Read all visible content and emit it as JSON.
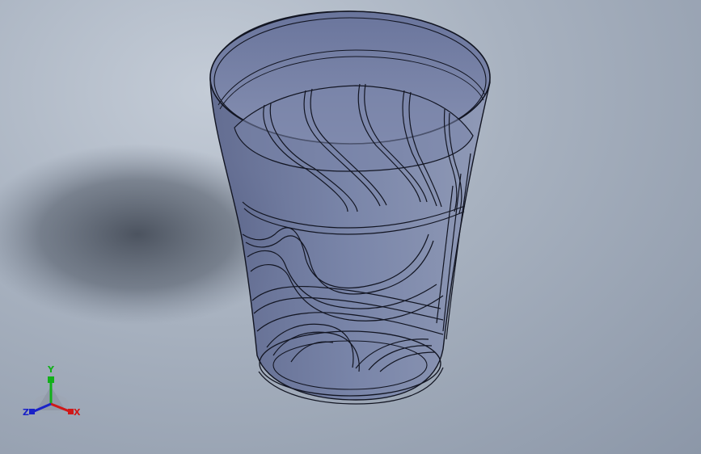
{
  "viewport": {
    "model": "cup-model",
    "colors": {
      "background_top": "#c4ccd7",
      "background_bottom": "#8c97a8",
      "shadow": "#3f4652",
      "model_fill": "#5f6a91",
      "edge": "#121522"
    }
  },
  "triad": {
    "x_label": "X",
    "y_label": "Y",
    "z_label": "Z",
    "colors": {
      "x": "#d01818",
      "y": "#12b01a",
      "z": "#1a22c8"
    }
  }
}
